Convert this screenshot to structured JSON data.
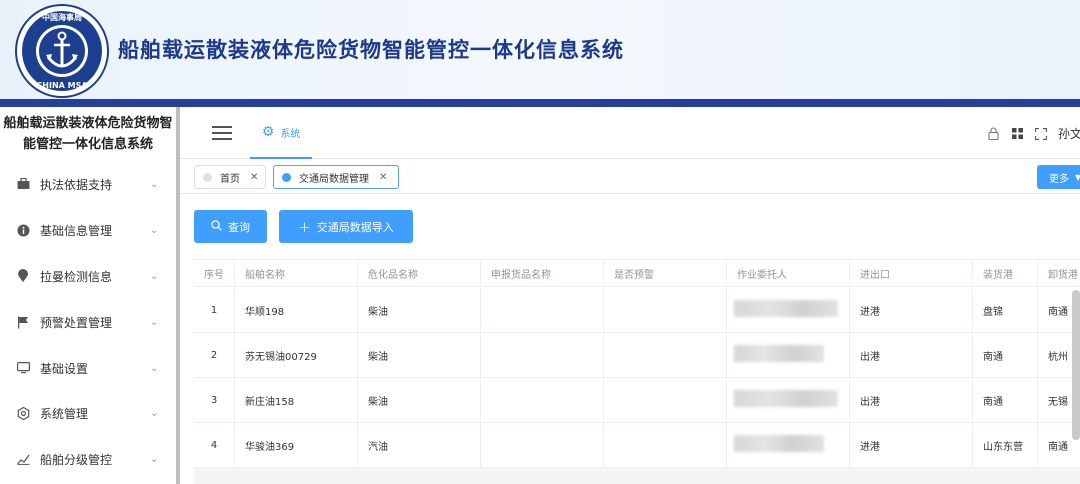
{
  "banner": {
    "title": "船舶载运散装液体危险货物智能管控一体化信息系统",
    "logo_text_top": "中国海事局",
    "logo_text_bottom": "CHINA MSA"
  },
  "sidebar": {
    "title": "船舶载运散装液体危险货物智能管控一体化信息系统",
    "items": [
      {
        "label": "执法依据支持",
        "icon": "briefcase-icon"
      },
      {
        "label": "基础信息管理",
        "icon": "info-circle-icon"
      },
      {
        "label": "拉曼检测信息",
        "icon": "location-pin-icon"
      },
      {
        "label": "预警处置管理",
        "icon": "flag-icon"
      },
      {
        "label": "基础设置",
        "icon": "monitor-icon"
      },
      {
        "label": "系统管理",
        "icon": "gear-outline-icon"
      },
      {
        "label": "船舶分级管控",
        "icon": "chart-icon"
      }
    ]
  },
  "topnav": {
    "system_tab": "系统",
    "user_name": "孙文"
  },
  "tabs": [
    {
      "label": "首页",
      "active": false
    },
    {
      "label": "交通局数据管理",
      "active": true
    }
  ],
  "more_label": "更多",
  "actions": {
    "query_label": "查询",
    "import_label": "交通局数据导入"
  },
  "table": {
    "columns": [
      "序号",
      "船舶名称",
      "危化品名称",
      "申报货品名称",
      "是否预警",
      "作业委托人",
      "进出口",
      "装货港",
      "卸货港"
    ],
    "rows": [
      {
        "index": "1",
        "ship": "华顺198",
        "chemical": "柴油",
        "declared": "",
        "warning": "",
        "direction": "进港",
        "load_port": "盘锦",
        "unload_port": "南通"
      },
      {
        "index": "2",
        "ship": "苏无锡油00729",
        "chemical": "柴油",
        "declared": "",
        "warning": "",
        "direction": "出港",
        "load_port": "南通",
        "unload_port": "杭州"
      },
      {
        "index": "3",
        "ship": "新庄油158",
        "chemical": "柴油",
        "declared": "",
        "warning": "",
        "direction": "出港",
        "load_port": "南通",
        "unload_port": "无锡"
      },
      {
        "index": "4",
        "ship": "华骏油369",
        "chemical": "汽油",
        "declared": "",
        "warning": "",
        "direction": "进港",
        "load_port": "山东东营",
        "unload_port": "南通"
      }
    ]
  },
  "colors": {
    "primary": "#409eff",
    "banner_bar": "#23409a",
    "banner_title": "#1d3a8a"
  }
}
